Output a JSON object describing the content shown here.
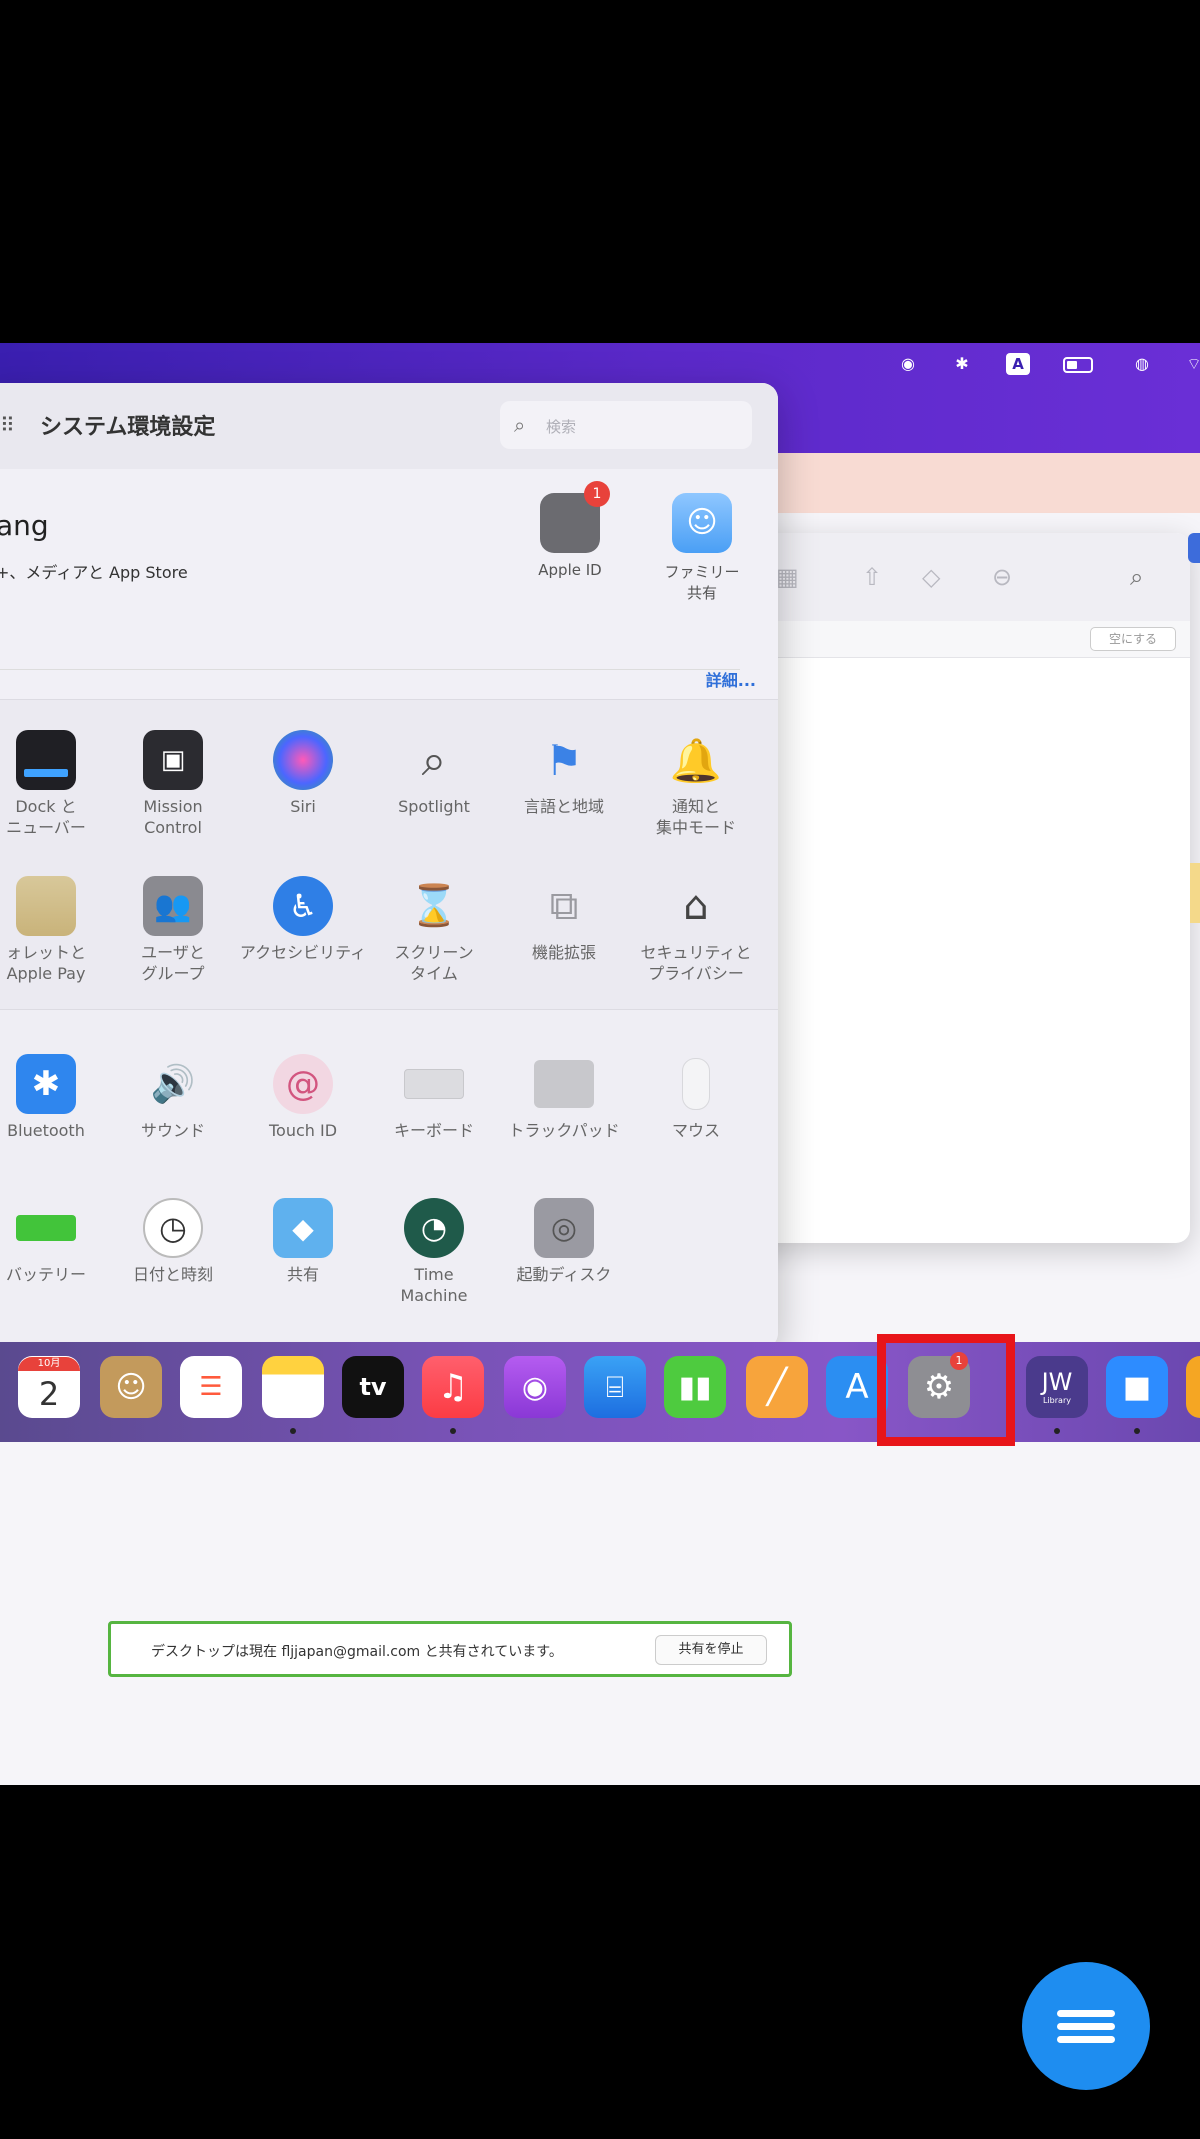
{
  "prefs": {
    "title": "システム環境設定",
    "search_placeholder": "検索",
    "account_name": "ang",
    "account_sub": "+、メディアと App Store",
    "apple_id_label": "Apple ID",
    "apple_id_badge": "1",
    "family_label_1": "ファミリー",
    "family_label_2": "共有",
    "details_link": "詳細..."
  },
  "row1": [
    {
      "l1": "Dock と",
      "l2": "ニューバー"
    },
    {
      "l1": "Mission",
      "l2": "Control"
    },
    {
      "l1": "Siri",
      "l2": ""
    },
    {
      "l1": "Spotlight",
      "l2": ""
    },
    {
      "l1": "言語と地域",
      "l2": ""
    },
    {
      "l1": "通知と",
      "l2": "集中モード"
    }
  ],
  "row2": [
    {
      "l1": "ォレットと",
      "l2": "Apple Pay"
    },
    {
      "l1": "ユーザと",
      "l2": "グループ"
    },
    {
      "l1": "アクセシビリティ",
      "l2": ""
    },
    {
      "l1": "スクリーン",
      "l2": "タイム"
    },
    {
      "l1": "機能拡張",
      "l2": ""
    },
    {
      "l1": "セキュリティと",
      "l2": "プライバシー"
    }
  ],
  "row3": [
    {
      "l1": "Bluetooth",
      "l2": ""
    },
    {
      "l1": "サウンド",
      "l2": ""
    },
    {
      "l1": "Touch ID",
      "l2": ""
    },
    {
      "l1": "キーボード",
      "l2": ""
    },
    {
      "l1": "トラックパッド",
      "l2": ""
    },
    {
      "l1": "マウス",
      "l2": ""
    }
  ],
  "row4": [
    {
      "l1": "バッテリー",
      "l2": ""
    },
    {
      "l1": "日付と時刻",
      "l2": ""
    },
    {
      "l1": "共有",
      "l2": ""
    },
    {
      "l1": "Time",
      "l2": "Machine"
    },
    {
      "l1": "起動ディスク",
      "l2": ""
    }
  ],
  "finder": {
    "button": "空にする"
  },
  "share": {
    "text": "デスクトップは現在 fljjapan@gmail.com と共有されています。",
    "stop_button": "共有を停止"
  },
  "dock": {
    "calendar_month": "10月",
    "calendar_day": "2",
    "tv_label": "tv",
    "jw_label": "JW",
    "jw_sub": "Library",
    "prefs_badge": "1"
  },
  "colors": {
    "highlight": "#e8151a",
    "fab": "#1e8df0",
    "link": "#2f6fd9"
  }
}
